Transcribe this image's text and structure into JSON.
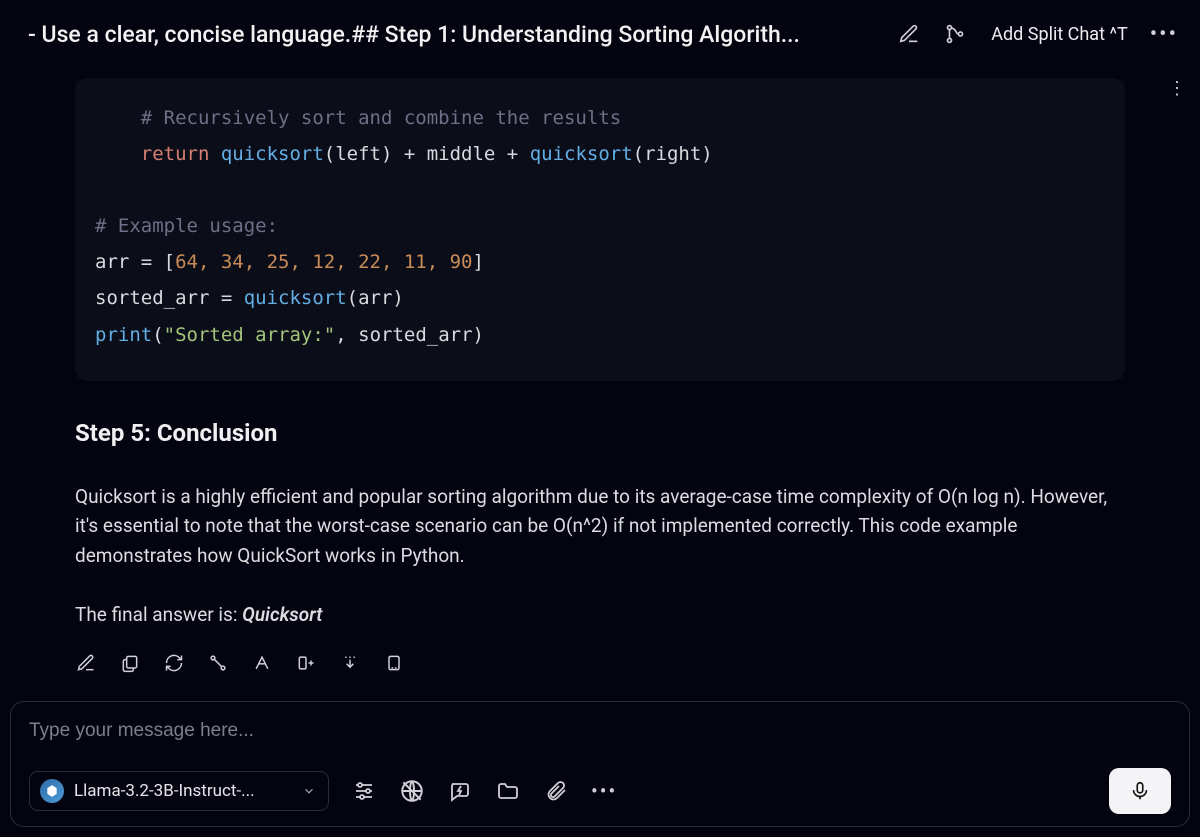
{
  "header": {
    "title": "- Use a clear, concise language.## Step 1: Understanding Sorting Algorith...",
    "split_chat_label": "Add Split Chat  ^T"
  },
  "content": {
    "code": {
      "line1_comment": "    # Recursively sort and combine the results",
      "line2_return": "    return",
      "line2_expr_a": " quicksort",
      "line2_expr_b": "(left) + middle + ",
      "line2_expr_c": "quicksort",
      "line2_expr_d": "(right)",
      "line3_comment": "# Example usage:",
      "line4_a": "arr = [",
      "line4_nums": "64, 34, 25, 12, 22, 11, 90",
      "line4_b": "]",
      "line5_a": "sorted_arr = ",
      "line5_fn": "quicksort",
      "line5_b": "(arr)",
      "line6_fn": "print",
      "line6_a": "(",
      "line6_str": "\"Sorted array:\"",
      "line6_b": ", sorted_arr)"
    },
    "heading": "Step 5: Conclusion",
    "paragraph": "Quicksort is a highly efficient and popular sorting algorithm due to its average-case time complexity of O(n log n). However, it's essential to note that the worst-case scenario can be O(n^2) if not implemented correctly. This code example demonstrates how QuickSort works in Python.",
    "final_prefix": "The final answer is: ",
    "final_answer": "Quicksort"
  },
  "input": {
    "placeholder": "Type your message here...",
    "model_name": "Llama-3.2-3B-Instruct-..."
  }
}
